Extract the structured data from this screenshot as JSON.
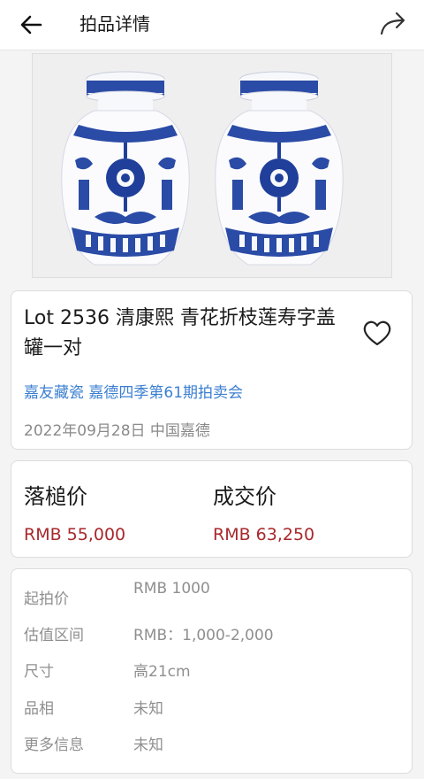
{
  "header": {
    "title": "拍品详情",
    "back_icon": "arrow-left-icon",
    "share_icon": "share-arrow-icon"
  },
  "lot": {
    "title": "Lot 2536 清康熙  青花折枝莲寿字盖罐一对",
    "favorite_icon": "heart-outline-icon",
    "auction": "嘉友藏瓷 嘉德四季第61期拍卖会",
    "date_location": "2022年09月28日 中国嘉德"
  },
  "prices": {
    "hammer_label": "落槌价",
    "hammer_value": "RMB 55,000",
    "final_label": "成交价",
    "final_value": "RMB 63,250"
  },
  "details": [
    {
      "key": "起拍价",
      "value": "RMB 1000"
    },
    {
      "key": "估值区间",
      "value": "RMB：1,000-2,000"
    },
    {
      "key": "尺寸",
      "value": "高21cm"
    },
    {
      "key": "品相",
      "value": "未知"
    },
    {
      "key": "更多信息",
      "value": "未知"
    }
  ],
  "colors": {
    "link_blue": "#3b7fd1",
    "price_red": "#a8282c",
    "porcelain_blue": "#1f3f9a"
  }
}
